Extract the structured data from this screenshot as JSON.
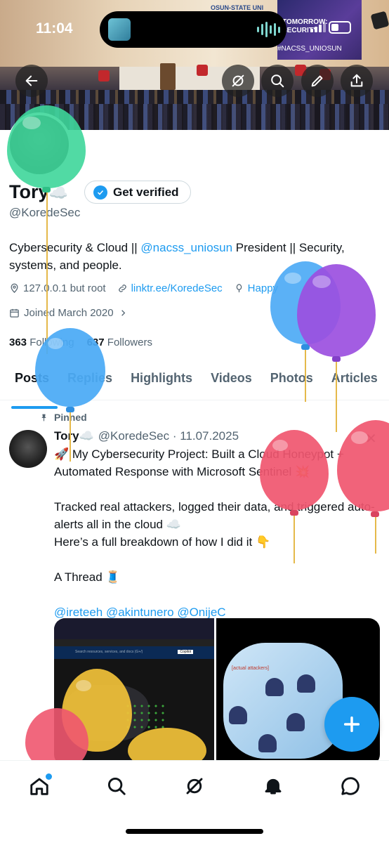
{
  "status_bar": {
    "time": "11:04"
  },
  "banner": {
    "screen_lines": [
      "TOMORROW:",
      "SECURITY"
    ],
    "screen_tag": "#NACSS_UNIOSUN",
    "top_text": "OSUN-STATE UNI",
    "stage_tag": "ACSS_UNIOSUN"
  },
  "header": {
    "back_icon": "arrow-left-icon",
    "grok_icon": "grok-icon",
    "search_icon": "search-icon",
    "edit_icon": "pencil-icon",
    "share_icon": "share-icon"
  },
  "profile": {
    "name": "Tory",
    "name_emoji": "☁️",
    "get_verified": "Get verified",
    "handle": "@KoredeSec",
    "bio_prefix": "Cybersecurity & Cloud || ",
    "bio_mention": "@nacss_uniosun",
    "bio_suffix": " President || Security, systems, and people.",
    "location": "127.0.0.1 but root",
    "link": "linktr.ee/KoredeSec",
    "birthday": "Happy",
    "joined": "Joined March 2020",
    "following_count": "363",
    "following_label": "Following",
    "followers_count": "637",
    "followers_label": "Followers"
  },
  "tabs": [
    "Posts",
    "Replies",
    "Highlights",
    "Videos",
    "Photos",
    "Articles"
  ],
  "tweet": {
    "pinned_label": "Pinned",
    "name": "Tory",
    "name_emoji": "☁️",
    "handle_date": "@KoredeSec · 11.07.2025",
    "body": "🚀 My Cybersecurity Project: Built a Cloud Honeypot + Automated Response with Microsoft Sentinel 💥\n\nTracked real attackers, logged their data, and triggered auto-alerts all in the cloud ☁️\nHere’s a full breakdown of how I did it 👇\n\nA Thread 🧵",
    "mentions": "@ireteeh @akintunero @OnijeC",
    "media_label": "[actual attackers]",
    "media_search_hint": "Search resources, services, and docs (G+/)",
    "media_copilot": "Copilot"
  },
  "bottom_nav": {
    "home_icon": "home-icon",
    "search_icon": "search-icon",
    "grok_icon": "grok-icon",
    "notifications_icon": "bell-icon",
    "messages_icon": "message-icon"
  },
  "colors": {
    "accent": "#1d9bf0",
    "text": "#0f1419",
    "muted": "#536471",
    "balloon_green": "#3ed69a",
    "balloon_blue": "#49a9f5",
    "balloon_purple": "#9b4fe0",
    "balloon_pink": "#f0566f",
    "balloon_yellow": "#f2c23a"
  }
}
